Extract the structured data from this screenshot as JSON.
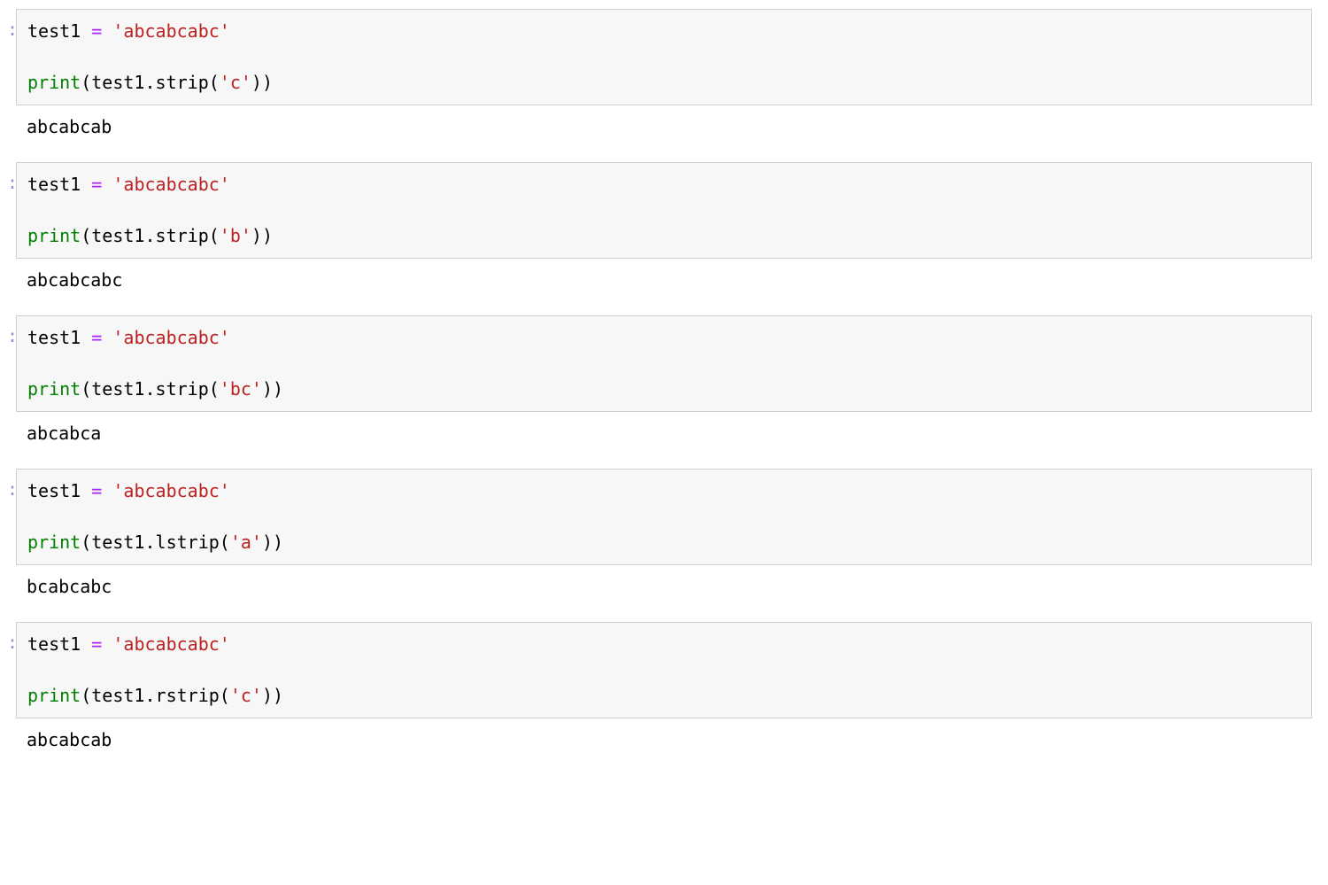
{
  "cells": [
    {
      "code_tokens": [
        {
          "t": "test1",
          "c": "name"
        },
        {
          "t": " ",
          "c": "punct"
        },
        {
          "t": "=",
          "c": "op"
        },
        {
          "t": " ",
          "c": "punct"
        },
        {
          "t": "'abcabcabc'",
          "c": "str"
        },
        {
          "t": "\n\n",
          "c": "punct"
        },
        {
          "t": "print",
          "c": "func"
        },
        {
          "t": "(",
          "c": "punct"
        },
        {
          "t": "test1",
          "c": "name"
        },
        {
          "t": ".",
          "c": "punct"
        },
        {
          "t": "strip",
          "c": "name"
        },
        {
          "t": "(",
          "c": "punct"
        },
        {
          "t": "'c'",
          "c": "str"
        },
        {
          "t": ")",
          "c": "punct"
        },
        {
          "t": ")",
          "c": "punct"
        }
      ],
      "output": "abcabcab"
    },
    {
      "code_tokens": [
        {
          "t": "test1",
          "c": "name"
        },
        {
          "t": " ",
          "c": "punct"
        },
        {
          "t": "=",
          "c": "op"
        },
        {
          "t": " ",
          "c": "punct"
        },
        {
          "t": "'abcabcabc'",
          "c": "str"
        },
        {
          "t": "\n\n",
          "c": "punct"
        },
        {
          "t": "print",
          "c": "func"
        },
        {
          "t": "(",
          "c": "punct"
        },
        {
          "t": "test1",
          "c": "name"
        },
        {
          "t": ".",
          "c": "punct"
        },
        {
          "t": "strip",
          "c": "name"
        },
        {
          "t": "(",
          "c": "punct"
        },
        {
          "t": "'b'",
          "c": "str"
        },
        {
          "t": ")",
          "c": "punct"
        },
        {
          "t": ")",
          "c": "punct"
        }
      ],
      "output": "abcabcabc"
    },
    {
      "code_tokens": [
        {
          "t": "test1",
          "c": "name"
        },
        {
          "t": " ",
          "c": "punct"
        },
        {
          "t": "=",
          "c": "op"
        },
        {
          "t": " ",
          "c": "punct"
        },
        {
          "t": "'abcabcabc'",
          "c": "str"
        },
        {
          "t": "\n\n",
          "c": "punct"
        },
        {
          "t": "print",
          "c": "func"
        },
        {
          "t": "(",
          "c": "punct"
        },
        {
          "t": "test1",
          "c": "name"
        },
        {
          "t": ".",
          "c": "punct"
        },
        {
          "t": "strip",
          "c": "name"
        },
        {
          "t": "(",
          "c": "punct"
        },
        {
          "t": "'bc'",
          "c": "str"
        },
        {
          "t": ")",
          "c": "punct"
        },
        {
          "t": ")",
          "c": "punct"
        }
      ],
      "output": "abcabca"
    },
    {
      "code_tokens": [
        {
          "t": "test1",
          "c": "name"
        },
        {
          "t": " ",
          "c": "punct"
        },
        {
          "t": "=",
          "c": "op"
        },
        {
          "t": " ",
          "c": "punct"
        },
        {
          "t": "'abcabcabc'",
          "c": "str"
        },
        {
          "t": "\n\n",
          "c": "punct"
        },
        {
          "t": "print",
          "c": "func"
        },
        {
          "t": "(",
          "c": "punct"
        },
        {
          "t": "test1",
          "c": "name"
        },
        {
          "t": ".",
          "c": "punct"
        },
        {
          "t": "lstrip",
          "c": "name"
        },
        {
          "t": "(",
          "c": "punct"
        },
        {
          "t": "'a'",
          "c": "str"
        },
        {
          "t": ")",
          "c": "punct"
        },
        {
          "t": ")",
          "c": "punct"
        }
      ],
      "output": "bcabcabc"
    },
    {
      "code_tokens": [
        {
          "t": "test1",
          "c": "name"
        },
        {
          "t": " ",
          "c": "punct"
        },
        {
          "t": "=",
          "c": "op"
        },
        {
          "t": " ",
          "c": "punct"
        },
        {
          "t": "'abcabcabc'",
          "c": "str"
        },
        {
          "t": "\n\n",
          "c": "punct"
        },
        {
          "t": "print",
          "c": "func"
        },
        {
          "t": "(",
          "c": "punct"
        },
        {
          "t": "test1",
          "c": "name"
        },
        {
          "t": ".",
          "c": "punct"
        },
        {
          "t": "rstrip",
          "c": "name"
        },
        {
          "t": "(",
          "c": "punct"
        },
        {
          "t": "'c'",
          "c": "str"
        },
        {
          "t": ")",
          "c": "punct"
        },
        {
          "t": ")",
          "c": "punct"
        }
      ],
      "output": "abcabcab"
    }
  ],
  "prompt_marker": ":"
}
